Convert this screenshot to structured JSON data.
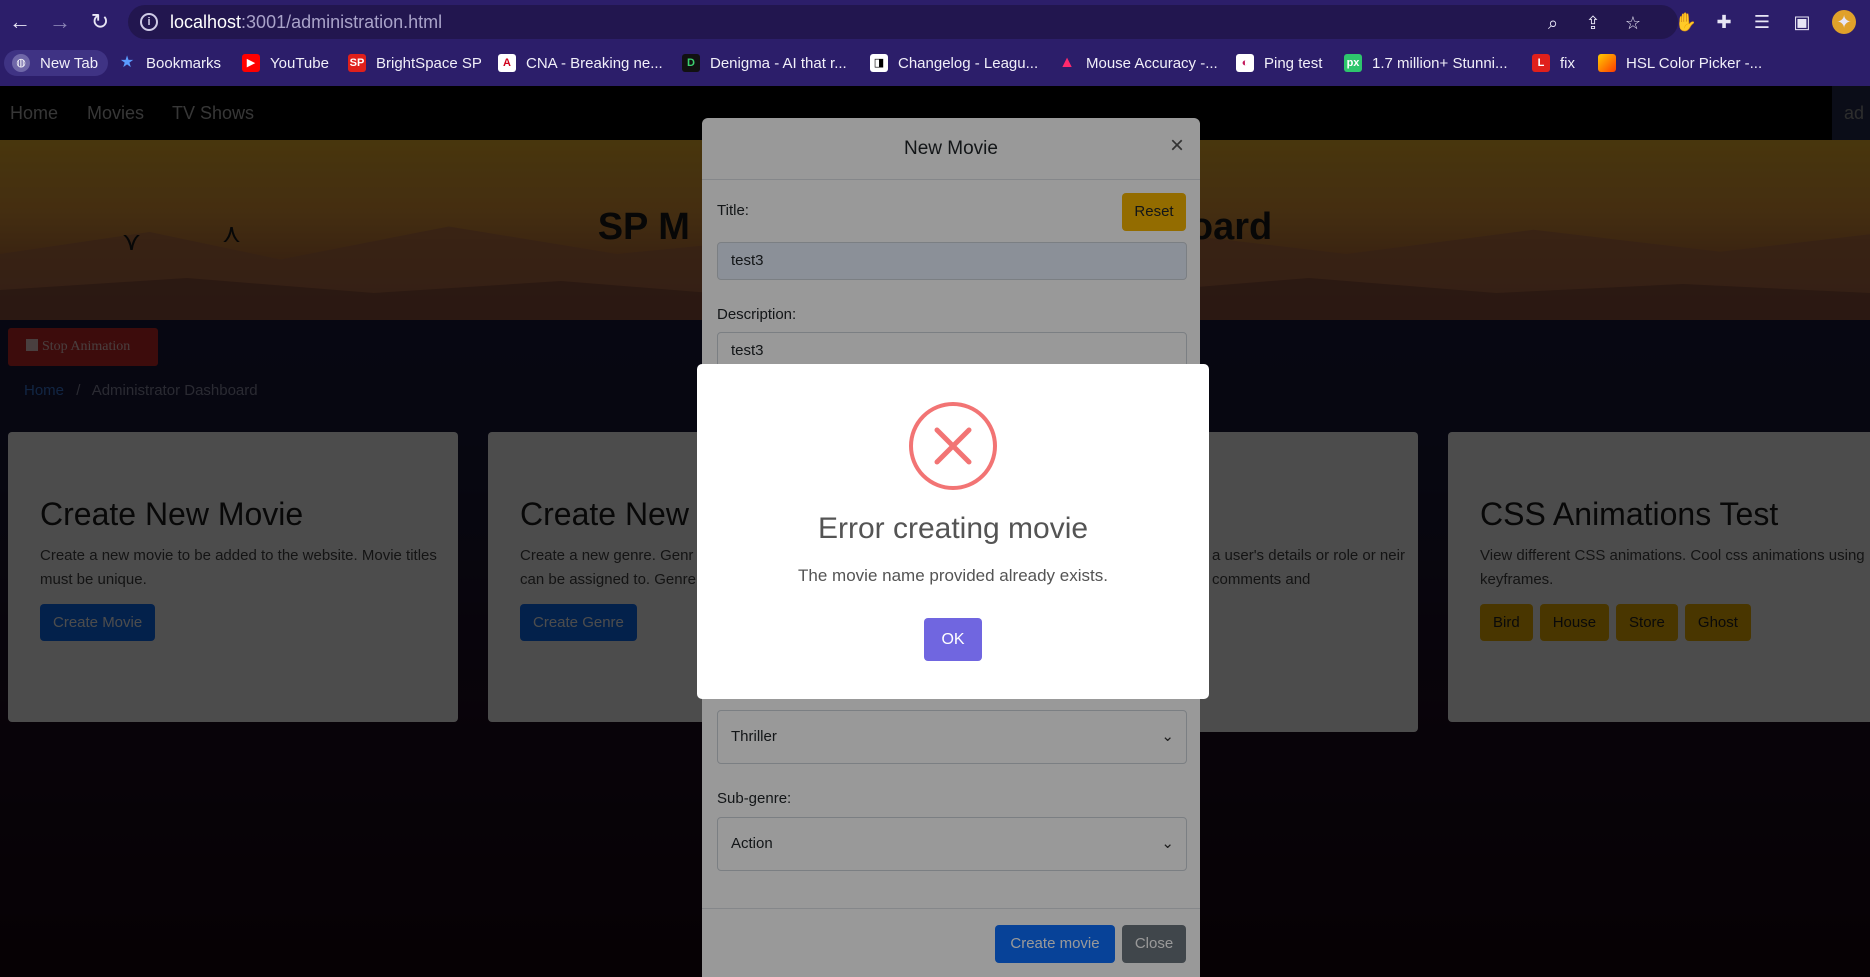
{
  "browser": {
    "url_host": "localhost",
    "url_rest": ":3001/administration.html",
    "bookmarks": [
      {
        "label": "New Tab",
        "icon": "globe-icon"
      },
      {
        "label": "Bookmarks",
        "icon": "star-icon"
      },
      {
        "label": "YouTube",
        "icon": "youtube-icon"
      },
      {
        "label": "BrightSpace SP",
        "icon": "sp-icon"
      },
      {
        "label": "CNA - Breaking ne...",
        "icon": "cna-icon"
      },
      {
        "label": "Denigma - AI that r...",
        "icon": "denigma-icon"
      },
      {
        "label": "Changelog - Leagu...",
        "icon": "changelog-icon"
      },
      {
        "label": "Mouse Accuracy -...",
        "icon": "mouse-accuracy-icon"
      },
      {
        "label": "Ping test",
        "icon": "ping-icon"
      },
      {
        "label": "1.7 million+ Stunni...",
        "icon": "pixabay-icon"
      },
      {
        "label": "fix",
        "icon": "l-icon"
      },
      {
        "label": "HSL Color Picker -...",
        "icon": "hsl-icon"
      }
    ]
  },
  "nav": {
    "items": [
      "Home",
      "Movies",
      "TV Shows"
    ],
    "user_chip": "ad"
  },
  "hero": {
    "title_left": "SP M",
    "title_right": "oard"
  },
  "stop_animation": "Stop Animation",
  "breadcrumb": {
    "home": "Home",
    "separator": "/",
    "current": "Administrator Dashboard"
  },
  "cards": [
    {
      "title": "Create New Movie",
      "desc": "Create a new movie to be added to the website. Movie titles must be unique.",
      "button": "Create Movie"
    },
    {
      "title": "Create New",
      "desc": "Create a new genre. Genr can be assigned to. Genre",
      "button": "Create Genre"
    },
    {
      "title": "",
      "desc": "a user's details or role or neir comments and",
      "button": ""
    },
    {
      "title": "CSS Animations Test",
      "desc": "View different CSS animations. Cool css animations using keyframes.",
      "buttons": [
        "Bird",
        "House",
        "Store",
        "Ghost"
      ]
    }
  ],
  "movie_modal": {
    "title": "New Movie",
    "title_label": "Title:",
    "title_value": "test3",
    "reset": "Reset",
    "description_label": "Description:",
    "description_value": "test3",
    "genre_value": "Thriller",
    "subgenre_label": "Sub-genre:",
    "subgenre_value": "Action",
    "create_button": "Create movie",
    "close_button": "Close"
  },
  "alert": {
    "title": "Error creating movie",
    "message": "The movie name provided already exists.",
    "ok": "OK",
    "icon": "error-x-icon",
    "color": "#f27474",
    "button_color": "#7066e0"
  }
}
